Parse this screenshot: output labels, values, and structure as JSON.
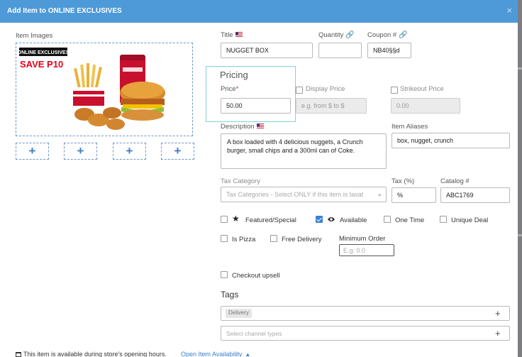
{
  "modal": {
    "title": "Add Item to ONLINE EXCLUSIVES",
    "close": "×"
  },
  "images": {
    "label": "Item Images",
    "banner_line1": "ONLINE EXCLUSIVES",
    "banner_line2": "SAVE P10",
    "add_buttons": [
      "+",
      "+",
      "+",
      "+"
    ]
  },
  "fields": {
    "title_label": "Title",
    "title_value": "NUGGET BOX",
    "quantity_label": "Quantity",
    "quantity_value": "",
    "coupon_label": "Coupon #",
    "coupon_value": "NB40§§d"
  },
  "pricing": {
    "heading": "Pricing",
    "price_label": "Price",
    "required_mark": "*",
    "price_value": "50.00",
    "display_price_label": "Display Price",
    "display_price_placeholder": "e.g. from $ to $",
    "strikeout_label": "Strikeout Price",
    "strikeout_value": "0.00"
  },
  "description": {
    "label": "Description",
    "value": "A box loaded with 4 delicious nuggets, a Crunch burger, small chips and a 300ml can of Coke.",
    "aliases_label": "Item Aliases",
    "aliases_value": "box, nugget, crunch"
  },
  "tax": {
    "category_label": "Tax Category",
    "category_placeholder": "Tax Categories - Select ONLY if this item is taxat",
    "percent_label": "Tax (%)",
    "percent_value": "%",
    "catalog_label": "Catalog #",
    "catalog_value": "ABC1769"
  },
  "options": {
    "featured": "Featured/Special",
    "available": "Available",
    "one_time": "One Time",
    "unique_deal": "Unique Deal",
    "is_pizza": "Is Pizza",
    "free_delivery": "Free Delivery",
    "minimum_order_label": "Minimum Order",
    "minimum_order_placeholder": "E.g: 0.0",
    "checkout_upsell": "Checkout upsell"
  },
  "tags": {
    "heading": "Tags",
    "chip": "Delivery",
    "channel_placeholder": "Select channel types",
    "add": "+"
  },
  "footer": {
    "availability_text": "This item is available during store's opening hours.",
    "availability_link": "Open Item Availability"
  },
  "colors": {
    "header": "#4e9ad9",
    "accent": "#3b82d6",
    "banner_red": "#e3001b"
  }
}
